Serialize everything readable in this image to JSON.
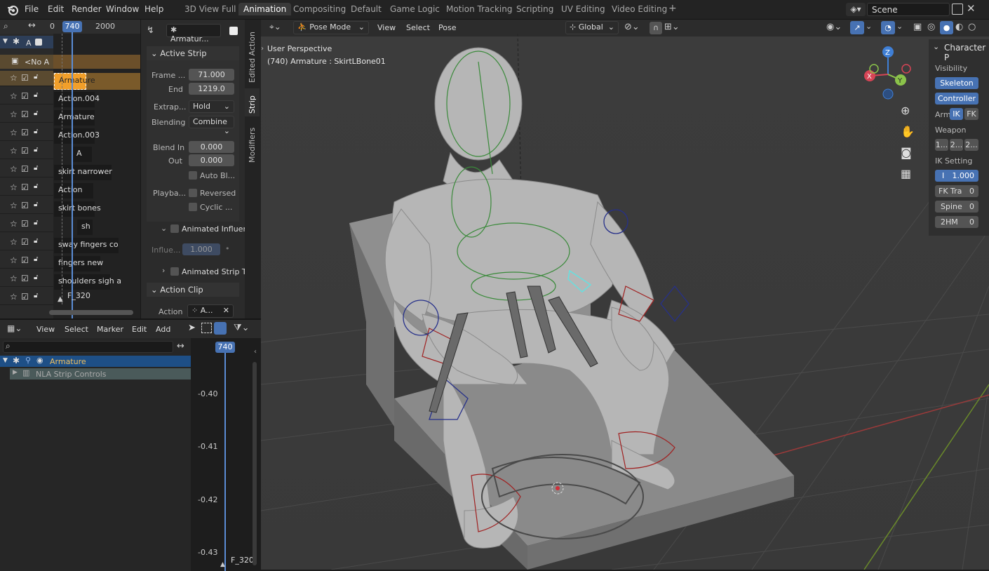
{
  "menubar": {
    "items": [
      "File",
      "Edit",
      "Render",
      "Window",
      "Help"
    ],
    "workspaces": [
      "3D View Full",
      "Animation",
      "Compositing",
      "Default",
      "Game Logic",
      "Motion Tracking",
      "Scripting",
      "UV Editing",
      "Video Editing"
    ],
    "scene": "Scene"
  },
  "nla": {
    "frame_start": "0",
    "current_frame": "740",
    "frame_end": "2000",
    "top_track": "A",
    "no_action": "<No A",
    "strips": [
      "Armature",
      "Action.004",
      "Armature",
      "Action.003",
      "A",
      "skirt narrower",
      "Action",
      "skirt bones",
      "sh",
      "sway fingers co",
      "fingers new",
      "shoulders sigh a"
    ],
    "marker": "F_320"
  },
  "strip_panel": {
    "object": "Armatur...",
    "active_strip": "Active Strip",
    "frame_label": "Frame ...",
    "frame_start": "71.000",
    "end_label": "End",
    "frame_end": "1219.0",
    "extrap_label": "Extrap...",
    "extrap_value": "Hold",
    "blending_label": "Blending",
    "blending_value": "Combine",
    "blend_in_label": "Blend In",
    "blend_in": "0.000",
    "out_label": "Out",
    "blend_out": "0.000",
    "auto_blend": "Auto Bl...",
    "playback_label": "Playba...",
    "reversed": "Reversed",
    "cyclic": "Cyclic ...",
    "animated_influence": "Animated Influen",
    "influence_label": "Influe...",
    "influence_value": "1.000",
    "animated_strip_time": "Animated Strip T",
    "action_clip": "Action Clip",
    "action_label": "Action",
    "action_value": "A...",
    "tabs": [
      "Edited Action",
      "Strip",
      "Modifiers"
    ]
  },
  "graph": {
    "menu": [
      "View",
      "Select",
      "Marker",
      "Edit",
      "Add"
    ],
    "current_frame": "740",
    "channels": [
      "Armature",
      "NLA Strip Controls"
    ],
    "y_ticks": [
      "-0.40",
      "-0.41",
      "-0.42",
      "-0.43"
    ],
    "marker": "F_320"
  },
  "viewport": {
    "mode": "Pose Mode",
    "menu": [
      "View",
      "Select",
      "Pose"
    ],
    "orientation": "Global",
    "perspective": "User Perspective",
    "object_info": "(740) Armature : SkirtLBone01",
    "gizmo": [
      "X",
      "Y",
      "Z"
    ]
  },
  "character_panel": {
    "title": "Character P",
    "visibility": "Visibility",
    "skeleton": "Skeleton",
    "controller": "Controller",
    "arm": "Arm",
    "ik": "IK",
    "fk": "FK",
    "weapon": "Weapon",
    "weapon_buttons": [
      "1...",
      "2...",
      "2..."
    ],
    "ik_setting": "IK Setting",
    "ik_value": "1.000",
    "ik_prefix": "I",
    "fk_tra": "FK Tra",
    "fk_tra_value": "0",
    "spine": "Spine",
    "spine_value": "0",
    "twohm": "2HM",
    "twohm_value": "0"
  },
  "colors": {
    "accent": "#4772b3",
    "active_strip": "#f19f2a",
    "selected_channel": "#1e4f86",
    "playhead": "#5b8dd6"
  }
}
